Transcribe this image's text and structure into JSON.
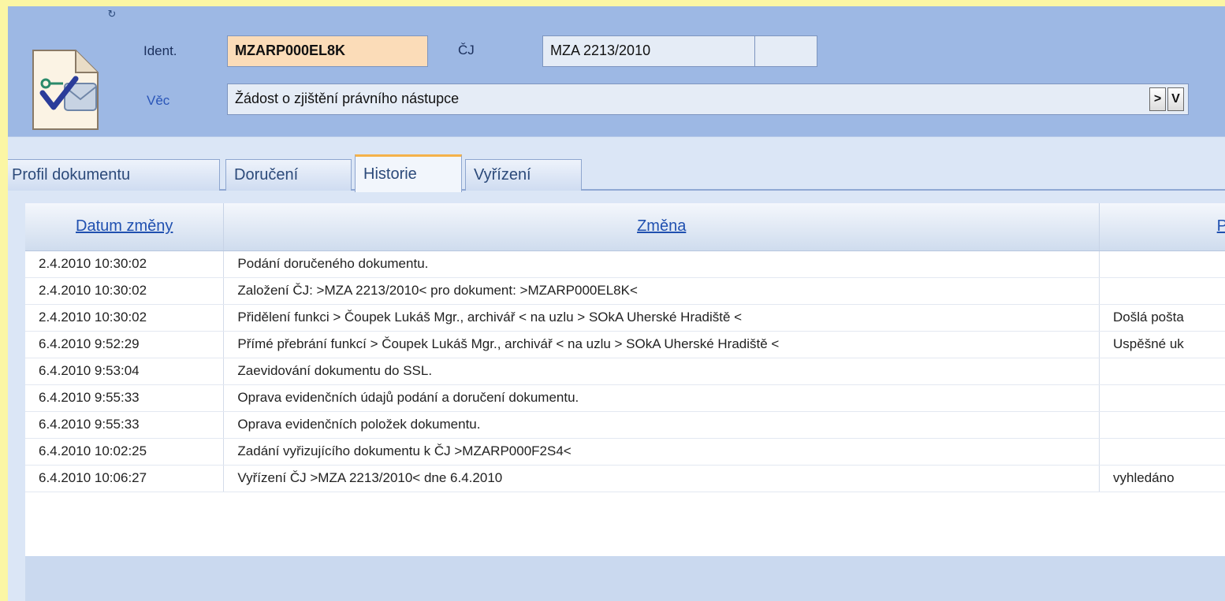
{
  "header": {
    "ident_label": "Ident.",
    "ident_value": "MZARP000EL8K",
    "cj_label": "ČJ",
    "cj_value": "MZA 2213/2010",
    "cj_extra_value": "",
    "vec_label": "Věc",
    "vec_value": "Žádost o zjištění právního nástupce",
    "next_button": ">",
    "v_button": "V"
  },
  "tabs": [
    {
      "label": "Profil dokumentu"
    },
    {
      "label": "Doručení"
    },
    {
      "label": "Historie"
    },
    {
      "label": "Vyřízení"
    }
  ],
  "active_tab": "Historie",
  "table": {
    "columns": [
      "Datum změny",
      "Změna",
      "P"
    ],
    "rows": [
      [
        "2.4.2010 10:30:02",
        "Podání doručeného dokumentu.",
        ""
      ],
      [
        "2.4.2010 10:30:02",
        "Založení ČJ: >MZA 2213/2010< pro dokument: >MZARP000EL8K<",
        ""
      ],
      [
        "2.4.2010 10:30:02",
        "Přidělení funkci > Čoupek Lukáš Mgr., archivář < na uzlu > SOkA Uherské Hradiště <",
        "Došlá pošta"
      ],
      [
        "6.4.2010 9:52:29",
        "Přímé přebrání funkcí > Čoupek Lukáš Mgr., archivář < na uzlu > SOkA Uherské Hradiště <",
        "Uspěšné uk"
      ],
      [
        "6.4.2010 9:53:04",
        "Zaevidování dokumentu do SSL.",
        ""
      ],
      [
        "6.4.2010 9:55:33",
        "Oprava evidenčních údajů podání a doručení dokumentu.",
        ""
      ],
      [
        "6.4.2010 9:55:33",
        "Oprava evidenčních položek dokumentu.",
        ""
      ],
      [
        "6.4.2010 10:02:25",
        "Zadání vyřizujícího dokumentu k ČJ >MZARP000F2S4<",
        ""
      ],
      [
        "6.4.2010 10:06:27",
        "Vyřízení ČJ >MZA 2213/2010< dne 6.4.2010",
        "vyhledáno"
      ]
    ]
  },
  "colors": {
    "page_background": "#fbf6a4",
    "header_background": "#9db8e4",
    "ident_field": "#fbdcb8",
    "active_tab_accent": "#f5b24a",
    "link_header": "#2050b0"
  }
}
